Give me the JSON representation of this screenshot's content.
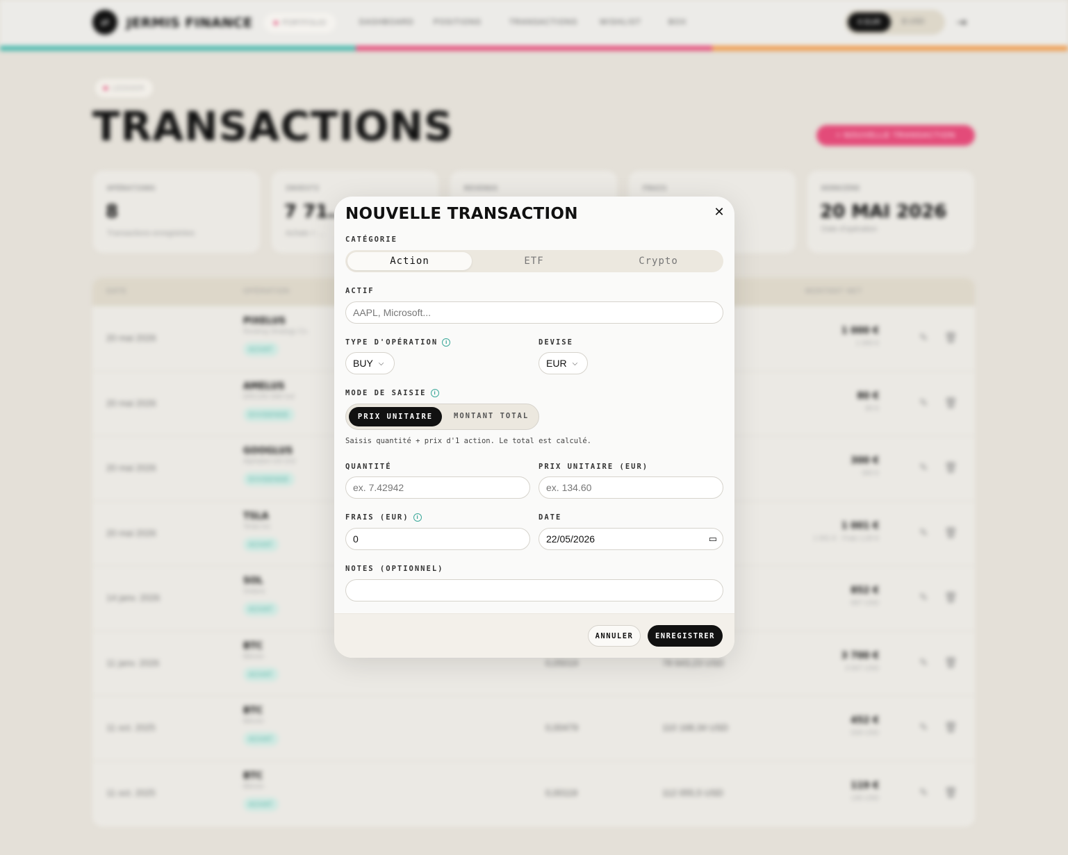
{
  "app": {
    "brand": "JERMIS FINANCE",
    "nav_active": "PORTFOLIO",
    "nav": [
      "DASHBOARD",
      "POSITIONS",
      "TRANSACTIONS",
      "WISHLIST",
      "BOX"
    ],
    "currency_on": "€ EUR",
    "currency_off": "$ USD",
    "stripe_colors": [
      "#45b7ac",
      "#e34b79",
      "#ef9a4a"
    ]
  },
  "page": {
    "badge": "LEDGER",
    "title": "TRANSACTIONS",
    "new_button": "+ NOUVELLE TRANSACTION"
  },
  "stats": [
    {
      "label": "OPÉRATIONS",
      "value": "8",
      "sub": "Transactions enregistrées"
    },
    {
      "label": "INVESTI",
      "value": "7 71…",
      "sub": "Achats + ..."
    },
    {
      "label": "REVENUS",
      "value": "",
      "sub": ""
    },
    {
      "label": "FRAIS",
      "value": "",
      "sub": ""
    },
    {
      "label": "DERNIÈRE",
      "value": "20 MAI 2026",
      "sub": "Date d'opération"
    }
  ],
  "table": {
    "headers": [
      "DATE",
      "OPÉRATION",
      "MONTANT NET"
    ],
    "rows": [
      {
        "date": "20 mai 2026",
        "ticker": "PIXELUS",
        "name": "Rocking Strategy Co.",
        "tag": "ACHAT",
        "qty": "",
        "price": "",
        "amount": "1 000 €",
        "amount_sub": "1 000 €"
      },
      {
        "date": "20 mai 2026",
        "ticker": "AMELUS",
        "name": "ERCON SIM Ind",
        "tag": "DIVIDENDE",
        "qty": "",
        "price": "",
        "amount": "80 €",
        "amount_sub": "80 €"
      },
      {
        "date": "20 mai 2026",
        "ticker": "GOOGLUS",
        "name": "Alphabet Intl Ord",
        "tag": "DIVIDENDE",
        "qty": "",
        "price": "",
        "amount": "300 €",
        "amount_sub": "300 €"
      },
      {
        "date": "20 mai 2026",
        "ticker": "TSLA",
        "name": "Tesla Inc",
        "tag": "ACHAT",
        "qty": "",
        "price": "",
        "amount": "1 001 €",
        "amount_sub": "1 001 € · Frais 1,00 €"
      },
      {
        "date": "14 janv. 2026",
        "ticker": "SOL",
        "name": "Solana",
        "tag": "ACHAT",
        "qty": "",
        "price": "",
        "amount": "852 €",
        "amount_sub": "997 USD"
      },
      {
        "date": "11 janv. 2026",
        "ticker": "BTC",
        "name": "Bitcoin",
        "tag": "ACHAT",
        "qty": "0,05019",
        "price": "78 643,23 USD",
        "amount": "3 700 €",
        "amount_sub": "3 947 USD"
      },
      {
        "date": "11 oct. 2025",
        "ticker": "BTC",
        "name": "Bitcoin",
        "tag": "ACHAT",
        "qty": "0,00479",
        "price": "110 168,34 USD",
        "amount": "452 €",
        "amount_sub": "528 USD"
      },
      {
        "date": "11 oct. 2025",
        "ticker": "BTC",
        "name": "Bitcoin",
        "tag": "ACHAT",
        "qty": "0,00119",
        "price": "112 055,5 USD",
        "amount": "119 €",
        "amount_sub": "135 USD"
      }
    ]
  },
  "modal": {
    "title": "NOUVELLE TRANSACTION",
    "category_label": "CATÉGORIE",
    "categories": [
      "Action",
      "ETF",
      "Crypto"
    ],
    "asset_label": "ACTIF",
    "asset_placeholder": "AAPL, Microsoft...",
    "op_type_label": "TYPE D'OPÉRATION",
    "op_type_value": "BUY",
    "currency_label": "DEVISE",
    "currency_value": "EUR",
    "mode_label": "MODE DE SAISIE",
    "mode_on": "PRIX UNITAIRE",
    "mode_off": "MONTANT TOTAL",
    "hint": "Saisis quantité + prix d'1 action. Le total est calculé.",
    "qty_label": "QUANTITÉ",
    "qty_placeholder": "ex. 7.42942",
    "price_label": "PRIX UNITAIRE (EUR)",
    "price_placeholder": "ex. 134.60",
    "fees_label": "FRAIS (EUR)",
    "fees_value": "0",
    "date_label": "DATE",
    "date_value": "22/05/2026",
    "notes_label": "NOTES (OPTIONNEL)",
    "notes_value": "",
    "cancel": "ANNULER",
    "save": "ENREGISTRER"
  }
}
